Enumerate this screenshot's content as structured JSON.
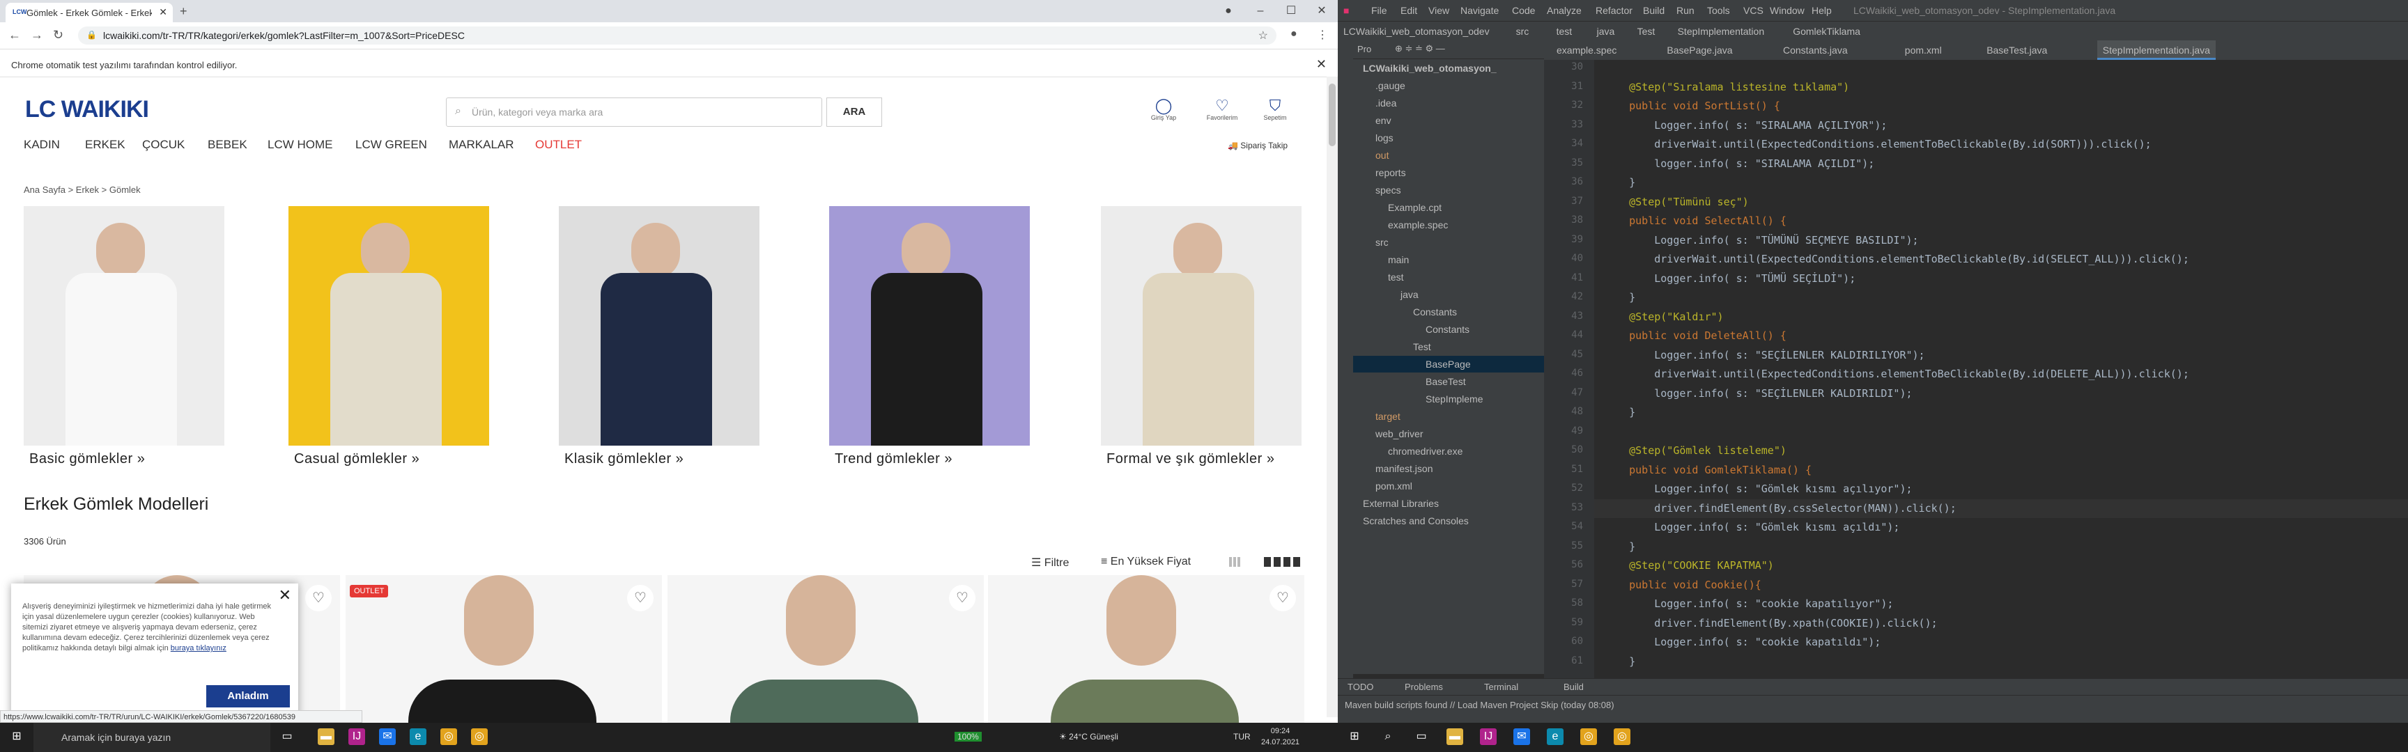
{
  "browser": {
    "tab_title": "Gömlek - Erkek Gömlek - Erkek Gi...",
    "favicon": "LCW",
    "url": "lcwaikiki.com/tr-TR/TR/kategori/erkek/gomlek?LastFilter=m_1007&Sort=PriceDESC",
    "info_message": "Chrome otomatik test yazılımı tarafından kontrol ediliyor."
  },
  "site": {
    "logo": "LC WAIKIKI",
    "search_placeholder": "Ürün, kategori veya marka ara",
    "search_button": "ARA",
    "header_icons": [
      {
        "label": "Giriş Yap",
        "icon": "user-icon"
      },
      {
        "label": "Favorilerim",
        "icon": "heart-icon"
      },
      {
        "label": "Sepetim",
        "icon": "bag-icon"
      }
    ],
    "menu": [
      "KADIN",
      "ERKEK",
      "ÇOCUK",
      "BEBEK",
      "LCW HOME",
      "LCW GREEN",
      "MARKALAR",
      "OUTLET"
    ],
    "shipping": "Sipariş Takip",
    "breadcrumb": "Ana Sayfa  >  Erkek  >  Gömlek",
    "categories": [
      {
        "label": "Basic gömlekler  »",
        "color": "#ededed",
        "shirt": "#f8f8f8"
      },
      {
        "label": "Casual gömlekler  »",
        "color": "#f2c21b",
        "shirt": "#e2dccb"
      },
      {
        "label": "Klasik gömlekler  »",
        "color": "#dedede",
        "shirt": "#1f2a44"
      },
      {
        "label": "Trend gömlekler  »",
        "color": "#a39ad6",
        "shirt": "#1c1c1c"
      },
      {
        "label": "Formal ve şık gömlekler  »",
        "color": "#ececec",
        "shirt": "#e0d6c0"
      }
    ],
    "page_title": "Erkek Gömlek Modelleri",
    "product_count": "3306 Ürün",
    "filter_label": "Filtre",
    "sort_label": "En Yüksek Fiyat",
    "products": [
      {
        "badge": "",
        "shirt": "#c9c3bb"
      },
      {
        "badge": "OUTLET",
        "shirt": "#1a1a1a"
      },
      {
        "badge": "",
        "shirt": "#4f6b5a"
      },
      {
        "badge": "",
        "shirt": "#6b7b5a"
      }
    ],
    "cookie_text": "Alışveriş deneyiminizi iyileştirmek ve hizmetlerimizi daha iyi hale getirmek için yasal düzenlemelere uygun çerezler (cookies) kullanıyoruz. Web sitemizi ziyaret etmeye ve alışveriş yapmaya devam ederseniz, çerez kullanımına devam edeceğiz. Çerez tercihlerinizi düzenlemek veya çerez politikamız hakkında detaylı bilgi almak için",
    "cookie_link": "buraya tıklayınız",
    "cookie_button": "Anladım",
    "status_url": "https://www.lcwaikiki.com/tr-TR/TR/urun/LC-WAIKIKI/erkek/Gomlek/5367220/1680539"
  },
  "taskbar": {
    "search_placeholder": "Aramak için buraya yazın",
    "battery": "100%",
    "weather": "24°C  Güneşli",
    "lang": "TUR",
    "time": "09:24",
    "date": "24.07.2021"
  },
  "ide": {
    "menu": [
      "File",
      "Edit",
      "View",
      "Navigate",
      "Code",
      "Analyze",
      "Refactor",
      "Build",
      "Run",
      "Tools",
      "VCS",
      "Window",
      "Help"
    ],
    "window_title": "LCWaikiki_web_otomasyon_odev - StepImplementation.java",
    "breadcrumbs": [
      "LCWaikiki_web_otomasyon_odev",
      "src",
      "test",
      "java",
      "Test",
      "StepImplementation",
      "GomlekTiklama"
    ],
    "project_label": "Pro",
    "tree": [
      {
        "name": "LCWaikiki_web_otomasyon_",
        "indent": 0,
        "sel": false,
        "bold": true
      },
      {
        "name": ".gauge",
        "indent": 1,
        "sel": false
      },
      {
        "name": ".idea",
        "indent": 1,
        "sel": false
      },
      {
        "name": "env",
        "indent": 1,
        "sel": false
      },
      {
        "name": "logs",
        "indent": 1,
        "sel": false
      },
      {
        "name": "out",
        "indent": 1,
        "sel": false,
        "orange": true
      },
      {
        "name": "reports",
        "indent": 1,
        "sel": false
      },
      {
        "name": "specs",
        "indent": 1,
        "sel": false
      },
      {
        "name": "Example.cpt",
        "indent": 2,
        "sel": false
      },
      {
        "name": "example.spec",
        "indent": 2,
        "sel": false
      },
      {
        "name": "src",
        "indent": 1,
        "sel": false
      },
      {
        "name": "main",
        "indent": 2,
        "sel": false
      },
      {
        "name": "test",
        "indent": 2,
        "sel": false
      },
      {
        "name": "java",
        "indent": 3,
        "sel": false
      },
      {
        "name": "Constants",
        "indent": 4,
        "sel": false
      },
      {
        "name": "Constants",
        "indent": 5,
        "sel": false
      },
      {
        "name": "Test",
        "indent": 4,
        "sel": false
      },
      {
        "name": "BasePage",
        "indent": 5,
        "sel": true
      },
      {
        "name": "BaseTest",
        "indent": 5,
        "sel": false
      },
      {
        "name": "StepImpleme",
        "indent": 5,
        "sel": false
      },
      {
        "name": "target",
        "indent": 1,
        "sel": false,
        "orange": true
      },
      {
        "name": "web_driver",
        "indent": 1,
        "sel": false
      },
      {
        "name": "chromedriver.exe",
        "indent": 2,
        "sel": false
      },
      {
        "name": "manifest.json",
        "indent": 1,
        "sel": false
      },
      {
        "name": "pom.xml",
        "indent": 1,
        "sel": false
      },
      {
        "name": "External Libraries",
        "indent": 0,
        "sel": false
      },
      {
        "name": "Scratches and Consoles",
        "indent": 0,
        "sel": false
      }
    ],
    "tabs": [
      {
        "label": "example.spec",
        "active": false
      },
      {
        "label": "BasePage.java",
        "active": false
      },
      {
        "label": "Constants.java",
        "active": false
      },
      {
        "label": "pom.xml",
        "active": false
      },
      {
        "label": "BaseTest.java",
        "active": false
      },
      {
        "label": "StepImplementation.java",
        "active": true
      }
    ],
    "lines": [
      {
        "n": "30",
        "t": ""
      },
      {
        "n": "31",
        "t": "    @Step(\"Sıralama listesine tıklama\")"
      },
      {
        "n": "32",
        "t": "    public void SortList() {"
      },
      {
        "n": "33",
        "t": "        Logger.info( s: \"SIRALAMA AÇILIYOR\");"
      },
      {
        "n": "34",
        "t": "        driverWait.until(ExpectedConditions.elementToBeClickable(By.id(SORT))).click();"
      },
      {
        "n": "35",
        "t": "        logger.info( s: \"SIRALAMA AÇILDI\");"
      },
      {
        "n": "36",
        "t": "    }"
      },
      {
        "n": "37",
        "t": "    @Step(\"Tümünü seç\")"
      },
      {
        "n": "38",
        "t": "    public void SelectAll() {"
      },
      {
        "n": "39",
        "t": "        Logger.info( s: \"TÜMÜNÜ SEÇMEYE BASILDI\");"
      },
      {
        "n": "40",
        "t": "        driverWait.until(ExpectedConditions.elementToBeClickable(By.id(SELECT_ALL))).click();"
      },
      {
        "n": "41",
        "t": "        Logger.info( s: \"TÜMÜ SEÇİLDİ\");"
      },
      {
        "n": "42",
        "t": "    }"
      },
      {
        "n": "43",
        "t": "    @Step(\"Kaldır\")"
      },
      {
        "n": "44",
        "t": "    public void DeleteAll() {"
      },
      {
        "n": "45",
        "t": "        Logger.info( s: \"SEÇİLENLER KALDIRILIYOR\");"
      },
      {
        "n": "46",
        "t": "        driverWait.until(ExpectedConditions.elementToBeClickable(By.id(DELETE_ALL))).click();"
      },
      {
        "n": "47",
        "t": "        logger.info( s: \"SEÇİLENLER KALDIRILDI\");"
      },
      {
        "n": "48",
        "t": "    }"
      },
      {
        "n": "49",
        "t": ""
      },
      {
        "n": "50",
        "t": "    @Step(\"Gömlek listeleme\")"
      },
      {
        "n": "51",
        "t": "    public void GomlekTiklama() {"
      },
      {
        "n": "52",
        "t": "        Logger.info( s: \"Gömlek kısmı açılıyor\");"
      },
      {
        "n": "53",
        "t": "        driver.findElement(By.cssSelector(MAN)).click();"
      },
      {
        "n": "54",
        "t": "        Logger.info( s: \"Gömlek kısmı açıldı\");"
      },
      {
        "n": "55",
        "t": "    }"
      },
      {
        "n": "56",
        "t": "    @Step(\"COOKIE KAPATMA\")"
      },
      {
        "n": "57",
        "t": "    public void Cookie(){"
      },
      {
        "n": "58",
        "t": "        Logger.info( s: \"cookie kapatılıyor\");"
      },
      {
        "n": "59",
        "t": "        driver.findElement(By.xpath(COOKIE)).click();"
      },
      {
        "n": "60",
        "t": "        Logger.info( s: \"cookie kapatıldı\");"
      },
      {
        "n": "61",
        "t": "    }"
      }
    ],
    "bottom_tabs": [
      "TODO",
      "Problems",
      "Terminal",
      "Build"
    ],
    "status": "Maven build scripts found // Load Maven Project  Skip (today 08:08)"
  }
}
